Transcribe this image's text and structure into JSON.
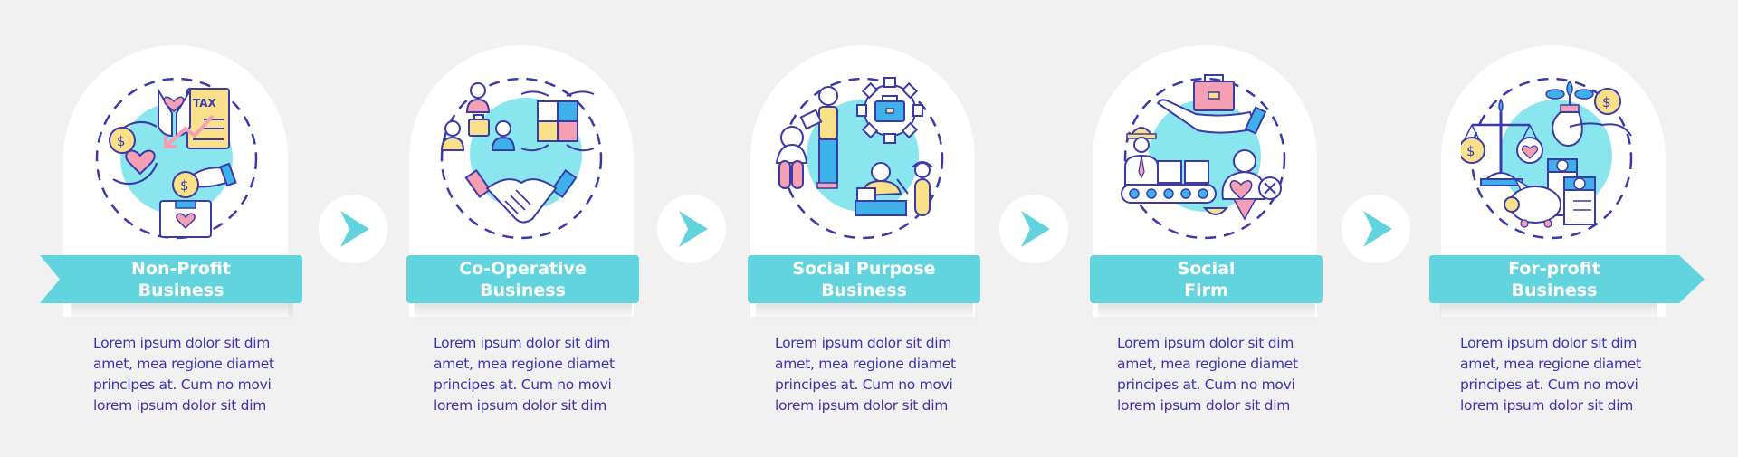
{
  "theme": {
    "accent": "#62d4de",
    "text": "#3b34ad",
    "background": "#f1f1f1",
    "icon_stroke": "#3a3aa8",
    "icon_fill_teal": "#8ae6ee",
    "icon_fill_pink": "#f49fb3",
    "icon_fill_yellow": "#fbe08a",
    "icon_fill_blue": "#3fb1ea"
  },
  "steps": [
    {
      "title_line1": "Non-Profit",
      "title_line2": "Business",
      "icon": "charity-donation-tax-icon",
      "description": [
        "Lorem ipsum dolor sit dim",
        "amet, mea regione diamet",
        "principes at. Cum no movi",
        "lorem ipsum dolor sit dim"
      ]
    },
    {
      "title_line1": "Co-Operative",
      "title_line2": "Business",
      "icon": "teamwork-puzzle-handshake-icon",
      "description": [
        "Lorem ipsum dolor sit dim",
        "amet, mea regione diamet",
        "principes at. Cum no movi",
        "lorem ipsum dolor sit dim"
      ]
    },
    {
      "title_line1": "Social Purpose",
      "title_line2": "Business",
      "icon": "social-workers-gear-icon",
      "description": [
        "Lorem ipsum dolor sit dim",
        "amet, mea regione diamet",
        "principes at. Cum no movi",
        "lorem ipsum dolor sit dim"
      ]
    },
    {
      "title_line1": "Social",
      "title_line2": "Firm",
      "icon": "worker-conveyor-briefcase-icon",
      "description": [
        "Lorem ipsum dolor sit dim",
        "amet, mea regione diamet",
        "principes at. Cum no movi",
        "lorem ipsum dolor sit dim"
      ]
    },
    {
      "title_line1": "For-profit",
      "title_line2": "Business",
      "icon": "scales-piggybank-money-icon",
      "description": [
        "Lorem ipsum dolor sit dim",
        "amet, mea regione diamet",
        "principes at. Cum no movi",
        "lorem ipsum dolor sit dim"
      ]
    }
  ],
  "connectors": [
    "next-arrow-icon",
    "next-arrow-icon",
    "next-arrow-icon",
    "next-arrow-icon"
  ]
}
